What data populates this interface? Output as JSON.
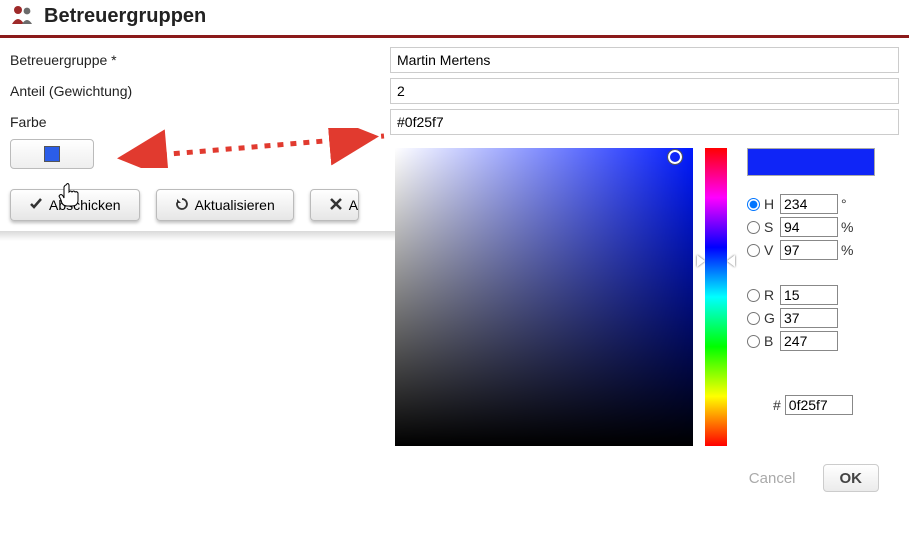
{
  "header": {
    "title": "Betreuergruppen"
  },
  "form": {
    "group_label": "Betreuergruppe *",
    "group_value": "Martin Mertens",
    "weight_label": "Anteil (Gewichtung)",
    "weight_value": "2",
    "color_label": "Farbe",
    "color_value": "#0f25f7"
  },
  "buttons": {
    "submit": "Abschicken",
    "refresh": "Aktualisieren",
    "cancel_partial": "A"
  },
  "picker": {
    "hue_deg": 234,
    "preview_color": "#0f25f7",
    "hsv": {
      "H": "234",
      "H_unit": "°",
      "S": "94",
      "S_unit": "%",
      "V": "97",
      "V_unit": "%"
    },
    "rgb": {
      "R": "15",
      "G": "37",
      "B": "247"
    },
    "hex": "0f25f7",
    "cancel": "Cancel",
    "ok": "OK"
  }
}
